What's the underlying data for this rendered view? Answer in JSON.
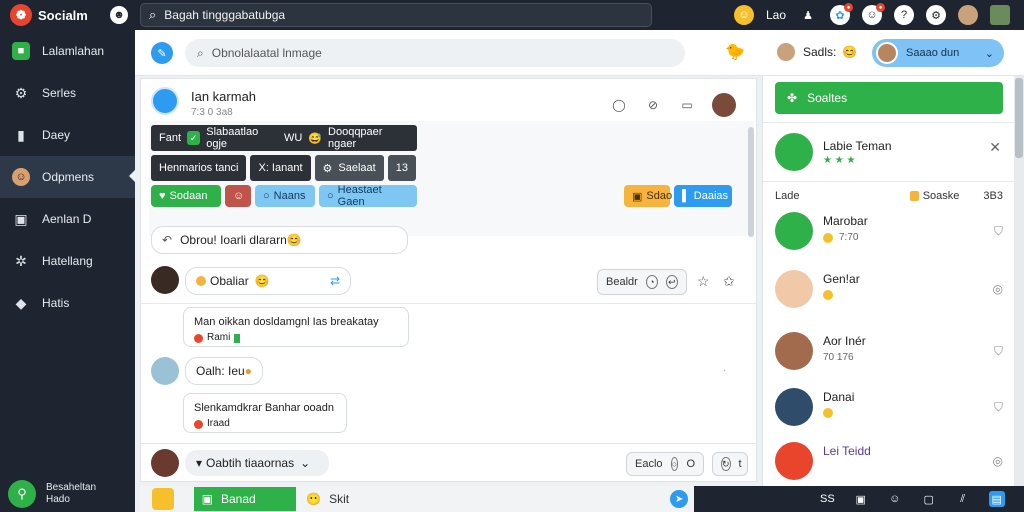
{
  "app": {
    "name": "Socialm"
  },
  "topbar": {
    "search_text": "Bagah tingggabatubga",
    "user_label": "Lao",
    "colors": {
      "bg": "#1e2530",
      "accent": "#e8452c"
    }
  },
  "sidebar": {
    "items": [
      {
        "label": "Lalamlahan",
        "icon": "square-badge-icon"
      },
      {
        "label": "Serles",
        "icon": "gear-icon"
      },
      {
        "label": "Daey",
        "icon": "book-icon"
      },
      {
        "label": "Odpmens",
        "icon": "person-circle-icon",
        "active": true
      },
      {
        "label": "Aenlan D",
        "icon": "layers-icon"
      },
      {
        "label": "Hatellang",
        "icon": "gear-icon"
      },
      {
        "label": "Hatis",
        "icon": "diamond-icon"
      }
    ],
    "footer": {
      "line1": "Besaheltan",
      "line2": "Hado"
    }
  },
  "subheader": {
    "search_text": "Obnolalaatal lnmage",
    "user_name": "Sadls:",
    "pill_label": "Saaao dun"
  },
  "chat": {
    "name": "Ian karmah",
    "subtitle": "7:3 0 3a8",
    "banner": {
      "row1": {
        "tag": "Fant",
        "text": "Slabaatlao ogje",
        "num": "WU",
        "tail": "Dooqqpaer ngaer"
      },
      "row2": {
        "a": "Henmarios tanci",
        "b": "X: Ianant",
        "c": "Saelaat",
        "d": "13"
      },
      "chips": {
        "green": "Sodaan",
        "lblue": "Naans",
        "lblue2": "Heastaet Gaen",
        "yellow": "Sdao",
        "blue": "Daaias"
      }
    },
    "messages": {
      "m1": "Obrou! Ioarli dlararn",
      "m2": "Obaliar",
      "m3_text": "Man oikkan dosldamgnl Ias breakatay",
      "m3_meta": "Rami",
      "m4": "Oalh: Ieu",
      "m5_text": "Slenkamdkrar Banhar ooadn",
      "m5_meta": "Iraad"
    },
    "actions": {
      "reply": "Bealdr"
    },
    "footer": {
      "dropdown": "Oabtih tiaaornas",
      "f1": "Eaclo",
      "f2": "O",
      "f3": "t"
    }
  },
  "compose": {
    "green_label": "Banad",
    "placeholder": "Skit"
  },
  "bottombar": {
    "label": "SS"
  },
  "rpanel": {
    "button_label": "Soaltes",
    "profile": {
      "name": "Labie Teman",
      "status": "★ ★ ★"
    },
    "filter": {
      "left": "Lade",
      "mid": "Soaske",
      "right": "3B3"
    },
    "contacts": [
      {
        "name": "Marobar",
        "meta": "7:70",
        "color": "#2fb14a"
      },
      {
        "name": "Gen!ar",
        "meta": "",
        "color": "#f2c9a8"
      },
      {
        "name": "Aor Inér",
        "meta": "70 176",
        "color": "#a36b4d"
      },
      {
        "name": "Danai",
        "meta": "",
        "color": "#2f4c6b"
      },
      {
        "name": "Lei Teidd",
        "meta": "",
        "color": "#e8452c"
      }
    ]
  }
}
